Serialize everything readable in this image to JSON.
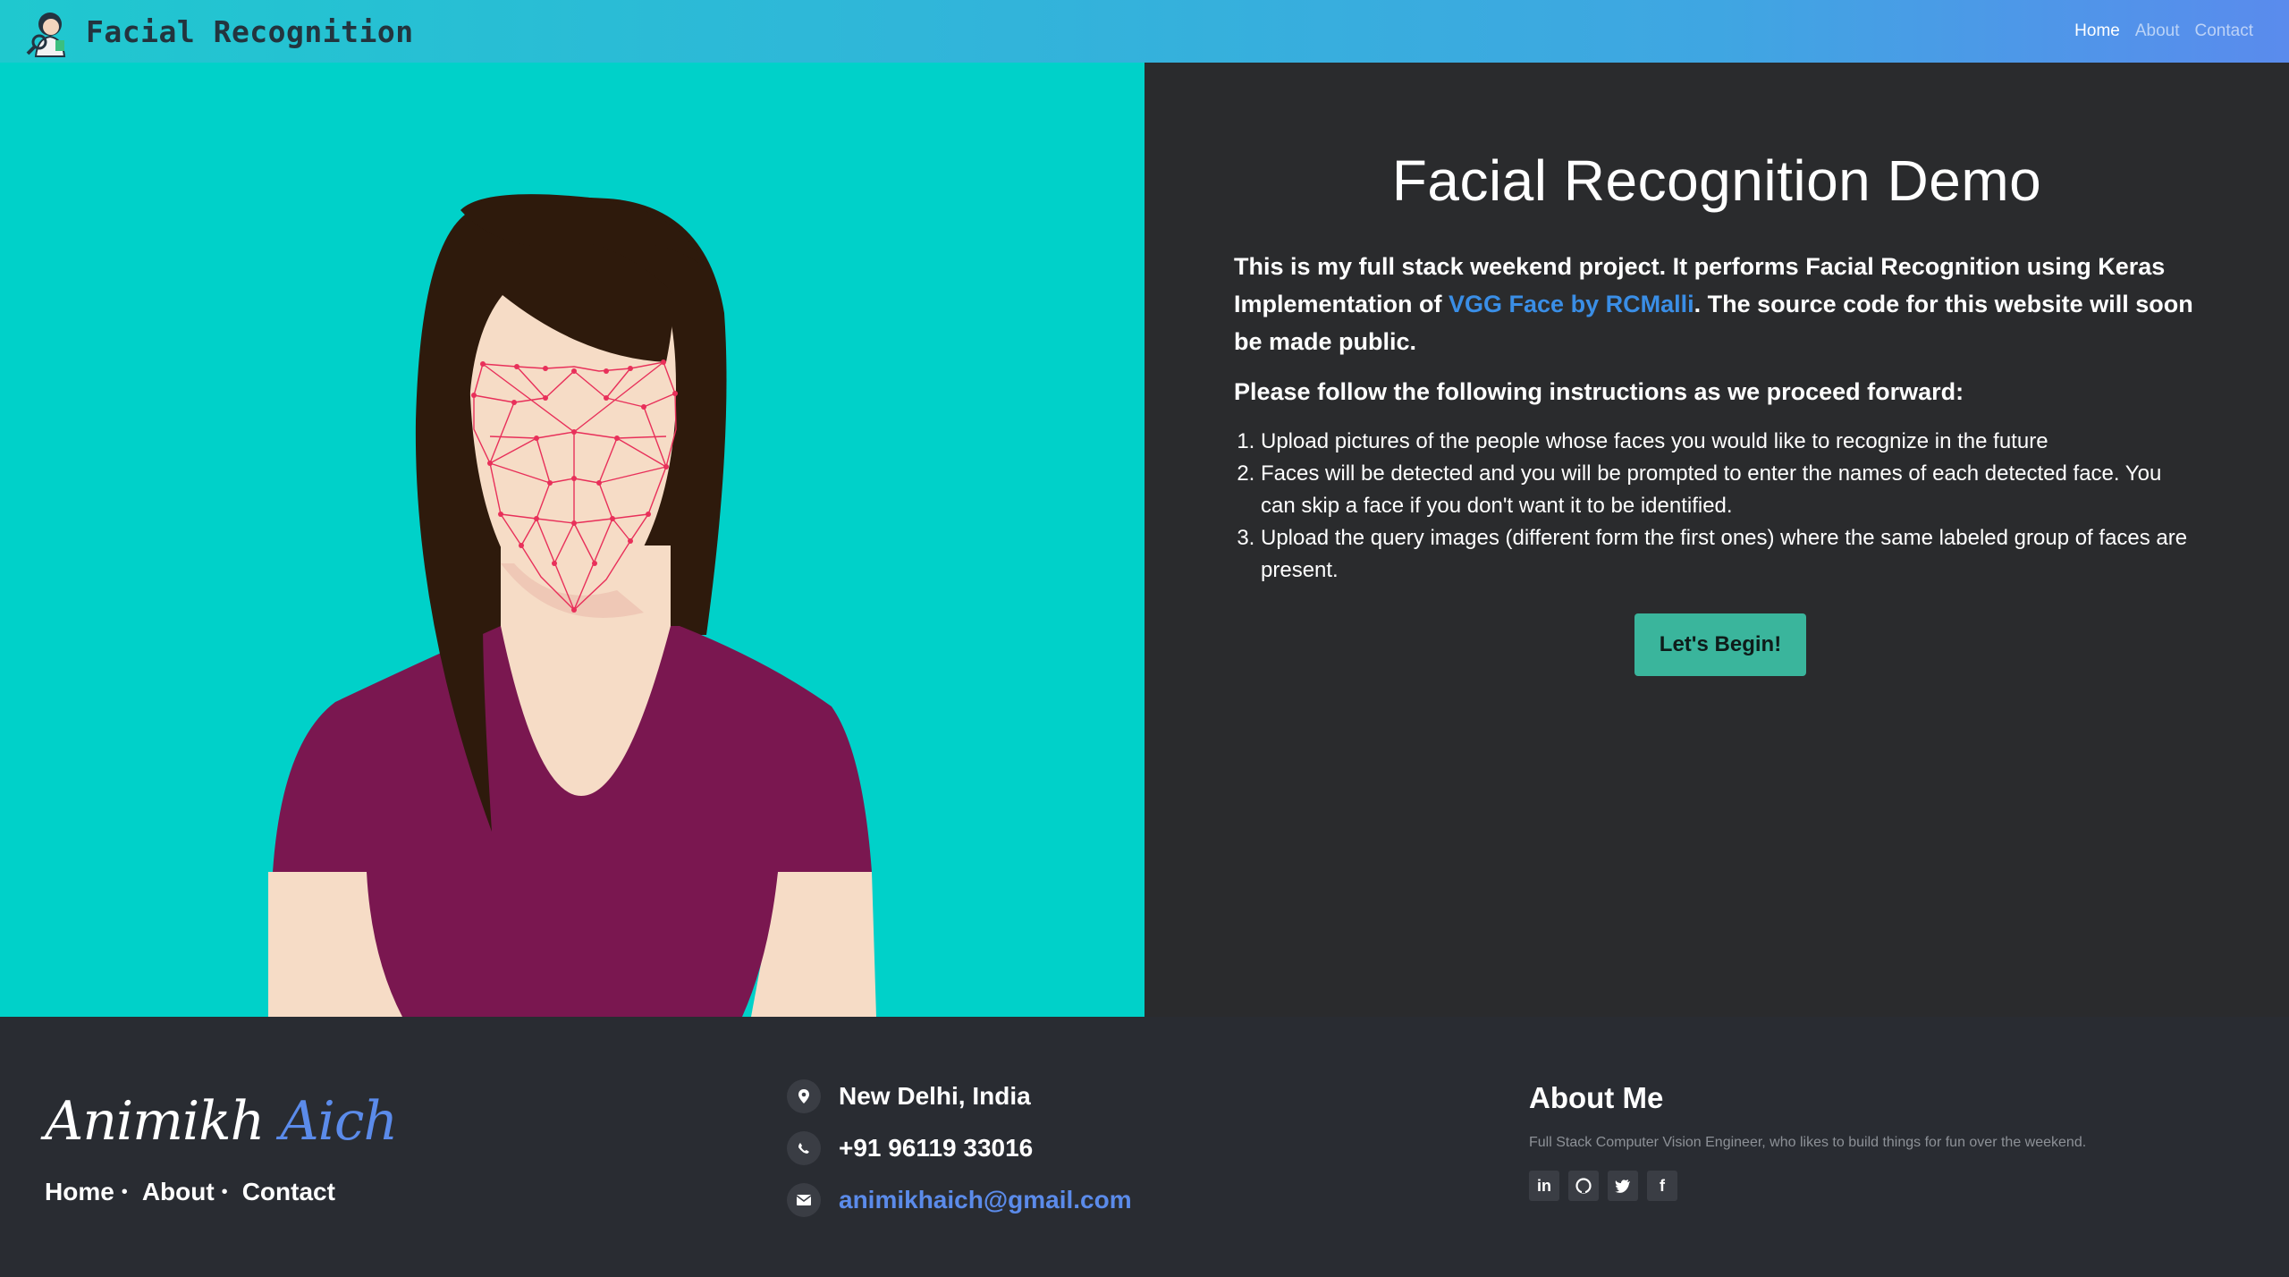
{
  "navbar": {
    "brand": "Facial Recognition",
    "links": [
      {
        "label": "Home",
        "active": true
      },
      {
        "label": "About",
        "active": false
      },
      {
        "label": "Contact",
        "active": false
      }
    ]
  },
  "hero": {
    "title": "Facial Recognition Demo",
    "intro_part1": "This is my full stack weekend project. It performs Facial Recognition using Keras Implementation of ",
    "intro_link": "VGG Face by RCMalli",
    "intro_part2": ". The source code for this website will soon be made public.",
    "instructions_heading": "Please follow the following instructions as we proceed forward:",
    "steps": [
      "Upload pictures of the people whose faces you would like to recognize in the future",
      "Faces will be detected and you will be prompted to enter the names of each detected face. You can skip a face if you don't want it to be identified.",
      "Upload the query images (different form the first ones) where the same labeled group of faces are present."
    ],
    "button": "Let's Begin!",
    "colors": {
      "left_bg": "#00d1c9",
      "right_bg": "#2a2b2d",
      "link": "#3a8ee6",
      "button": "#3ab59c"
    }
  },
  "footer": {
    "name_first": "Animikh",
    "name_last": "Aich",
    "links": [
      "Home",
      "About",
      "Contact"
    ],
    "contact": {
      "location": "New Delhi, India",
      "phone": "+91 96119 33016",
      "email": "animikhaich@gmail.com"
    },
    "about_title": "About Me",
    "about_desc": "Full Stack Computer Vision Engineer, who likes to build things for fun over the weekend.",
    "socials": [
      "linkedin-icon",
      "github-icon",
      "twitter-icon",
      "facebook-icon"
    ]
  }
}
